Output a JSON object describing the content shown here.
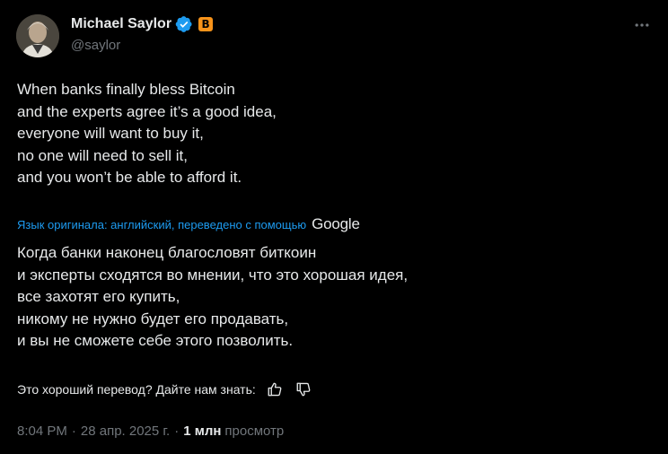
{
  "author": {
    "display_name": "Michael Saylor",
    "handle": "@saylor",
    "verified_icon": "verified-badge-icon",
    "affiliate_icon": "bitcoin-badge-icon",
    "affiliate_glyph": "B",
    "avatar": "avatar-photo"
  },
  "colors": {
    "background": "#000000",
    "text_primary": "#e7e9ea",
    "text_secondary": "#71767b",
    "link": "#1d9bf0",
    "verified": "#1d9bf0",
    "affiliate": "#f7931a"
  },
  "more_icon": "more-horizontal-icon",
  "original_lines": [
    "When banks finally bless Bitcoin",
    "and the experts agree it’s a good idea,",
    "everyone will want to buy it,",
    "no one will need to sell it,",
    "and you won’t be able to afford it."
  ],
  "translation": {
    "meta_text": "Язык оригинала: английский, переведено с помощью",
    "provider": "Google",
    "lines": [
      "Когда банки наконец благословят биткоин",
      "и эксперты сходятся во мнении, что это хорошая идея,",
      "все захотят его купить,",
      "никому не нужно будет его продавать,",
      "и вы не сможете себе этого позволить."
    ],
    "feedback_prompt": "Это хороший перевод? Дайте нам знать:",
    "thumbs_up_icon": "thumbs-up-icon",
    "thumbs_down_icon": "thumbs-down-icon"
  },
  "meta": {
    "time": "8:04 PM",
    "separator": "·",
    "date": "28 апр. 2025 г.",
    "views_count": "1 млн",
    "views_label": "просмотр"
  }
}
